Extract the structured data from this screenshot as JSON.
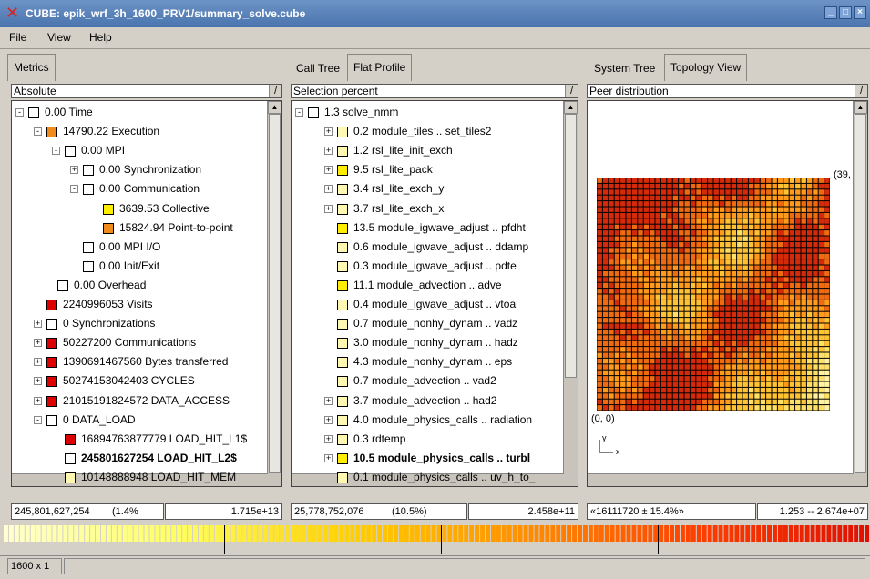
{
  "window": {
    "title": "CUBE: epik_wrf_3h_1600_PRV1/summary_solve.cube",
    "controls": [
      "_",
      "□",
      "×"
    ]
  },
  "menu": [
    "File",
    "View",
    "Help"
  ],
  "metrics_pane": {
    "tab": "Metrics",
    "mode": "Absolute",
    "rows": [
      {
        "value": "0.00",
        "name": "Time"
      },
      {
        "value": "14790.22",
        "name": "Execution"
      },
      {
        "value": "0.00",
        "name": "MPI"
      },
      {
        "value": "0.00",
        "name": "Synchronization"
      },
      {
        "value": "0.00",
        "name": "Communication"
      },
      {
        "value": "3639.53",
        "name": "Collective"
      },
      {
        "value": "15824.94",
        "name": "Point-to-point"
      },
      {
        "value": "0.00",
        "name": "MPI I/O"
      },
      {
        "value": "0.00",
        "name": "Init/Exit"
      },
      {
        "value": "0.00",
        "name": "Overhead"
      },
      {
        "value": "2240996053",
        "name": "Visits"
      },
      {
        "value": "0",
        "name": "Synchronizations"
      },
      {
        "value": "50227200",
        "name": "Communications"
      },
      {
        "value": "1390691467560",
        "name": "Bytes transferred"
      },
      {
        "value": "50274153042403",
        "name": "CYCLES"
      },
      {
        "value": "21015191824572",
        "name": "DATA_ACCESS"
      },
      {
        "value": "0",
        "name": "DATA_LOAD"
      },
      {
        "value": "16894763877779",
        "name": "LOAD_HIT_L1$"
      },
      {
        "value": "245801627254",
        "name": "LOAD_HIT_L2$"
      },
      {
        "value": "10148888948",
        "name": "LOAD_HIT_MEM"
      }
    ],
    "status_left": "245,801,627,254",
    "status_pct": "(1.4%",
    "status_right": "1.715e+13"
  },
  "calltree_pane": {
    "tabs": [
      "Call Tree",
      "Flat Profile"
    ],
    "mode": "Selection percent",
    "rows": [
      {
        "value": "1.3",
        "name": "solve_nmm"
      },
      {
        "value": "0.2",
        "name": "module_tiles .. set_tiles2"
      },
      {
        "value": "1.2",
        "name": "rsl_lite_init_exch"
      },
      {
        "value": "9.5",
        "name": "rsl_lite_pack"
      },
      {
        "value": "3.4",
        "name": "rsl_lite_exch_y"
      },
      {
        "value": "3.7",
        "name": "rsl_lite_exch_x"
      },
      {
        "value": "13.5",
        "name": "module_igwave_adjust .. pfdht"
      },
      {
        "value": "0.6",
        "name": "module_igwave_adjust .. ddamp"
      },
      {
        "value": "0.3",
        "name": "module_igwave_adjust .. pdte"
      },
      {
        "value": "11.1",
        "name": "module_advection .. adve"
      },
      {
        "value": "0.4",
        "name": "module_igwave_adjust .. vtoa"
      },
      {
        "value": "0.7",
        "name": "module_nonhy_dynam .. vadz"
      },
      {
        "value": "3.0",
        "name": "module_nonhy_dynam .. hadz"
      },
      {
        "value": "4.3",
        "name": "module_nonhy_dynam .. eps"
      },
      {
        "value": "0.7",
        "name": "module_advection .. vad2"
      },
      {
        "value": "3.7",
        "name": "module_advection .. had2"
      },
      {
        "value": "4.0",
        "name": "module_physics_calls .. radiation"
      },
      {
        "value": "0.3",
        "name": "rdtemp"
      },
      {
        "value": "10.5",
        "name": "module_physics_calls .. turbl"
      },
      {
        "value": "0.1",
        "name": "module_physics_calls .. uv_h_to_"
      }
    ],
    "status_left": "25,778,752,076",
    "status_pct": "(10.5%)",
    "status_right": "2.458e+11"
  },
  "system_pane": {
    "tabs": [
      "System Tree",
      "Topology View"
    ],
    "mode": "Peer distribution",
    "corner_top_right": "(39,",
    "corner_bottom_left": "(0, 0)",
    "axis_y": "y",
    "axis_x": "x",
    "status_left": "«16111720 ± 15.4%»",
    "status_right": "1.253 -- 2.674e+07"
  },
  "footer": {
    "dims": "1600 x 1"
  },
  "colors": {
    "scale": [
      "#ffffd0",
      "#ffff60",
      "#ffd000",
      "#ff9000",
      "#ff4000",
      "#e01000"
    ],
    "square_white": "#ffffff",
    "square_yellow": "#ffee00",
    "square_lightyellow": "#fff8b0",
    "square_orange": "#f08a1a",
    "square_red": "#dd0000"
  }
}
